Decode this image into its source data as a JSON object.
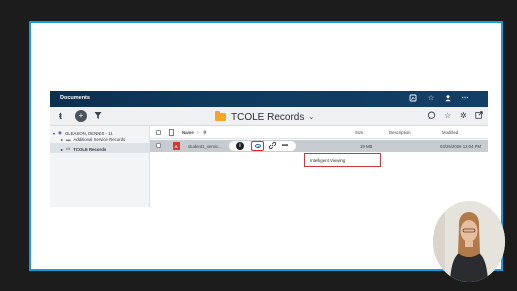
{
  "app": {
    "title": "Documents",
    "titlebar_icons": [
      "dashboard-icon",
      "star-icon",
      "user-icon",
      "more-icon"
    ]
  },
  "toolbar": {
    "left_icons": [
      "back-icon",
      "add-icon",
      "filter-icon"
    ],
    "folder_title": "TCOLE Records",
    "right_icons": [
      "comment-icon",
      "star-icon",
      "gear-icon",
      "external-link-icon"
    ]
  },
  "tree": {
    "root": "GLEASON, DENNIS - 11",
    "items": [
      {
        "label": "Additional Service Records"
      },
      {
        "label": "TCOLE Records"
      }
    ]
  },
  "list": {
    "columns": {
      "name": "Name",
      "sort_arrow": "↑",
      "size": "Size",
      "description": "Description",
      "modified": "Modified"
    },
    "rows": [
      {
        "name": "student1_servic...",
        "size": "19 MB",
        "description": "",
        "modified": "03/25/2026 12:04 PM"
      }
    ]
  },
  "row_actions": {
    "info": "i",
    "more": "•••"
  },
  "tooltip": {
    "label": "Intelligent Viewing"
  },
  "colors": {
    "accent_border": "#1a9ad6",
    "titlebar": "#0f3a5e",
    "highlight_red": "#d3363a",
    "folder": "#f5a623",
    "pdf": "#d9342b"
  }
}
